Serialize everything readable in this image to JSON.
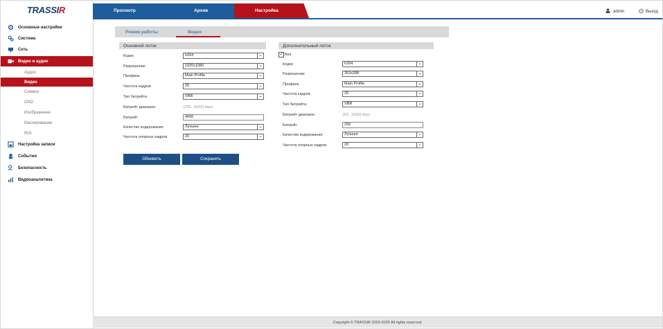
{
  "app": {
    "logo_main": "TRASSI",
    "logo_accent": "R"
  },
  "header": {
    "tabs": [
      {
        "label": "Просмотр"
      },
      {
        "label": "Архив"
      },
      {
        "label": "Настройка"
      }
    ],
    "user_label": "admin",
    "logout_label": "Выход"
  },
  "sidebar": {
    "items": [
      {
        "label": "Основные настройки",
        "icon": "gear-icon"
      },
      {
        "label": "Система",
        "icon": "gears-icon"
      },
      {
        "label": "Сеть",
        "icon": "network-icon"
      },
      {
        "label": "Видео и аудио",
        "icon": "video-icon"
      },
      {
        "label": "Настройка записи",
        "icon": "record-icon"
      },
      {
        "label": "События",
        "icon": "event-icon"
      },
      {
        "label": "Безопасность",
        "icon": "security-icon"
      },
      {
        "label": "Видеоаналитика",
        "icon": "analytics-icon"
      }
    ],
    "subitems": [
      {
        "label": "Аудио"
      },
      {
        "label": "Видео"
      },
      {
        "label": "Снимок"
      },
      {
        "label": "OSD"
      },
      {
        "label": "Изображение"
      },
      {
        "label": "Маскирование"
      },
      {
        "label": "ROI"
      }
    ]
  },
  "subtabs": [
    {
      "label": "Режим работы"
    },
    {
      "label": "Видео"
    }
  ],
  "main_stream": {
    "title": "Основной поток",
    "codec_label": "Кодек",
    "codec_value": "h264",
    "resolution_label": "Разрешение",
    "resolution_value": "1920x1080",
    "profile_label": "Профиль",
    "profile_value": "Main Profile",
    "framerate_label": "Частота кадров",
    "framerate_value": "25",
    "bitrate_type_label": "Тип битрейта",
    "bitrate_type_value": "VBR",
    "bitrate_range_label": "Битрейт диапазон",
    "bitrate_range_value": "[256...8000] kbps",
    "bitrate_label": "Битрейт",
    "bitrate_value": "4000",
    "quality_label": "Качество кодирования",
    "quality_value": "Лучшее",
    "gop_label": "Частота опорных кадров",
    "gop_value": "20"
  },
  "sub_stream": {
    "title": "Дополнительный поток",
    "enable_label": "Вкл",
    "enabled": true,
    "codec_label": "Кодек",
    "codec_value": "h264",
    "resolution_label": "Разрешение",
    "resolution_value": "352x288",
    "profile_label": "Профиль",
    "profile_value": "Main Profile",
    "framerate_label": "Частота кадров",
    "framerate_value": "25",
    "bitrate_type_label": "Тип битрейта",
    "bitrate_type_value": "VBR",
    "bitrate_range_label": "Битрейт диапазон",
    "bitrate_range_value": "[50...1000] kbps",
    "bitrate_label": "Битрейт",
    "bitrate_value": "256",
    "quality_label": "Качество кодирования",
    "quality_value": "Лучшее",
    "gop_label": "Частота опорных кадров",
    "gop_value": "20"
  },
  "actions": {
    "refresh_label": "Обновить",
    "save_label": "Сохранить"
  },
  "footer": {
    "copyright": "Copyright © TRASSIR 2020-2025 All rights reserved."
  },
  "colors": {
    "brand_blue": "#1e5c9e",
    "brand_red": "#b5121b",
    "button_blue": "#1d4f86"
  }
}
